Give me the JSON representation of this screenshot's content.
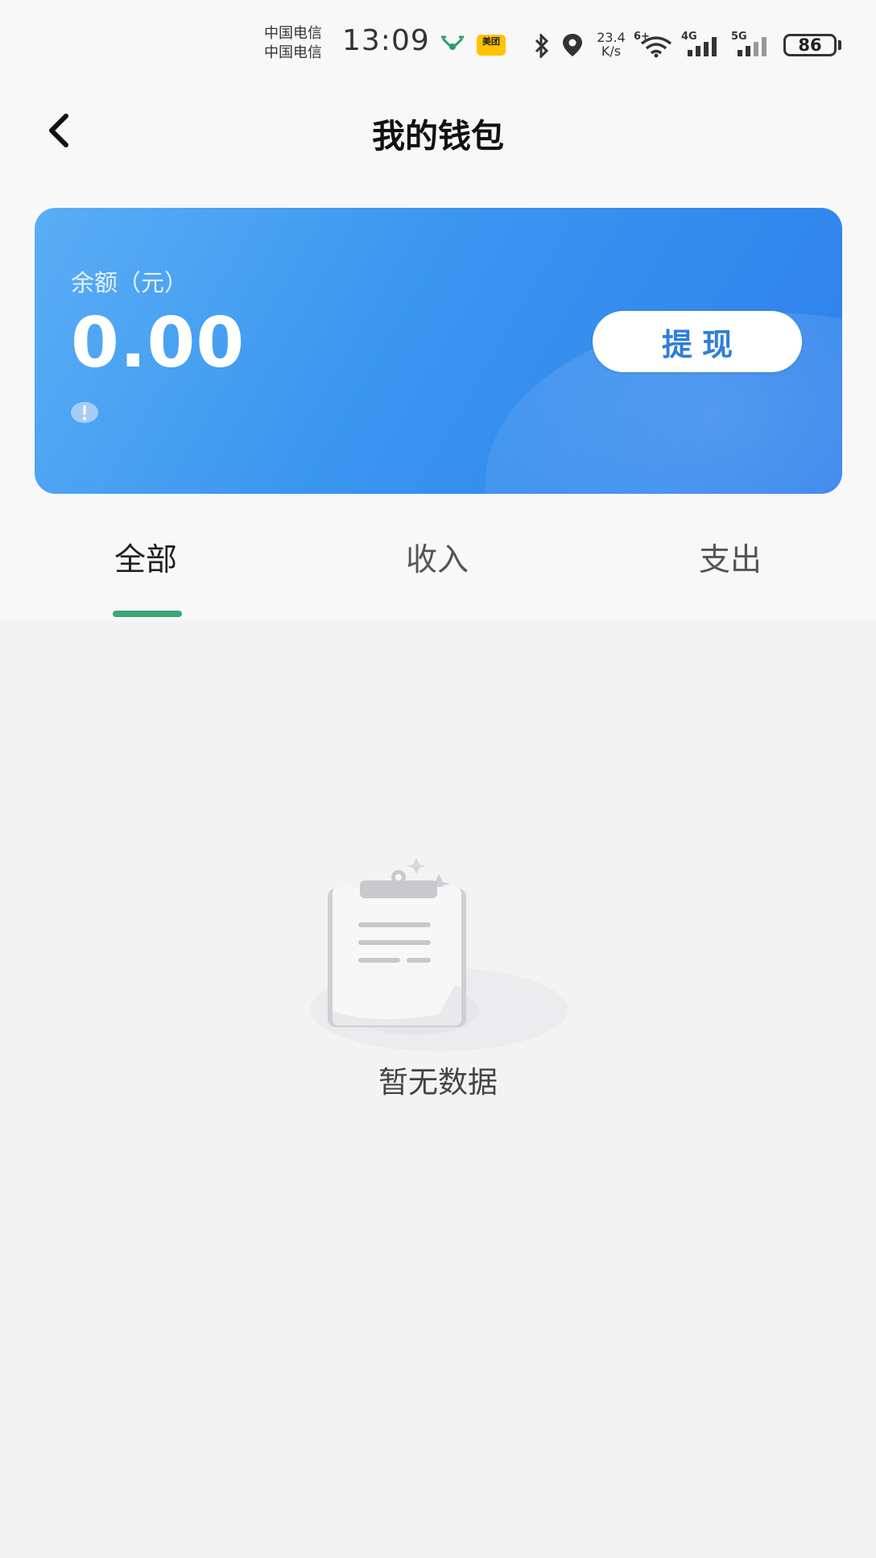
{
  "status_bar": {
    "carrier_1": "中国电信",
    "carrier_2": "中国电信",
    "time": "13:09",
    "app_badge": "美团",
    "net_speed_value": "23.4",
    "net_speed_unit": "K/s",
    "wifi_label": "6+",
    "signal_1_label": "4G",
    "signal_2_label": "5G",
    "battery": "86",
    "icons": [
      "drone-icon",
      "meituan-app-icon",
      "bluetooth-icon",
      "location-icon",
      "wifi-icon",
      "signal-icon",
      "signal-icon",
      "battery-icon"
    ]
  },
  "header": {
    "back_icon": "chevron-left-icon",
    "title": "我的钱包"
  },
  "balance_card": {
    "label": "余额（元）",
    "value": "0.00",
    "info_icon": "exclamation-info-icon",
    "withdraw_label": "提现"
  },
  "tabs": [
    {
      "label": "全部",
      "active": true
    },
    {
      "label": "收入",
      "active": false
    },
    {
      "label": "支出",
      "active": false
    }
  ],
  "empty_state": {
    "icon": "clipboard-icon",
    "text": "暂无数据"
  },
  "colors": {
    "card_gradient_start": "#5aaef5",
    "card_gradient_end": "#2e80ec",
    "tab_indicator": "#3ba776",
    "withdraw_text": "#2f7ed8"
  }
}
